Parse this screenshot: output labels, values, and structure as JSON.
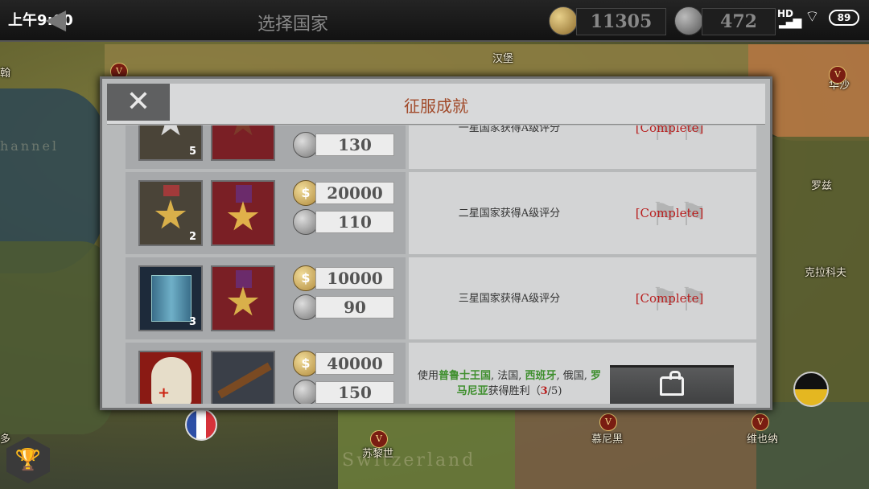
{
  "status_bar": {
    "time": "上午9:00",
    "network": "HD",
    "battery": "89"
  },
  "top_bar": {
    "title": "选择国家",
    "gold": "11305",
    "medals": "472"
  },
  "map_labels": [
    {
      "text": "汉堡"
    },
    {
      "text": "华沙"
    },
    {
      "text": "罗兹"
    },
    {
      "text": "克拉科夫"
    },
    {
      "text": "苏黎世"
    },
    {
      "text": "慕尼黑"
    },
    {
      "text": "维也纳"
    },
    {
      "text": "翰"
    },
    {
      "text": "多"
    },
    {
      "text": "Switzerland"
    },
    {
      "text": "hannel"
    }
  ],
  "dialog": {
    "title": "征服成就",
    "close_icon": "close-x-icon",
    "achievements": [
      {
        "rank": "5",
        "gold": "",
        "medal": "130",
        "description": "一星国家获得A级评分",
        "status": "[Complete]"
      },
      {
        "rank": "2",
        "gold": "20000",
        "medal": "110",
        "description": "二星国家获得A级评分",
        "status": "[Complete]"
      },
      {
        "rank": "3",
        "gold": "10000",
        "medal": "90",
        "description": "三星国家获得A级评分",
        "status": "[Complete]"
      },
      {
        "rank": "",
        "gold": "40000",
        "medal": "150",
        "desc_prefix": "使用",
        "desc_c1": "普鲁士王国",
        "desc_sep1": ", 法国, ",
        "desc_c2": "西班牙",
        "desc_sep2": ", 俄国, ",
        "desc_c3": "罗马尼亚",
        "desc_suffix": "获得胜利（",
        "progress_done": "3",
        "progress_total": "/5)",
        "status_icon": "chest-icon"
      }
    ]
  },
  "colors": {
    "title": "#a14a2a",
    "complete": "#b81d1d",
    "country_green": "#3f8f2e"
  }
}
